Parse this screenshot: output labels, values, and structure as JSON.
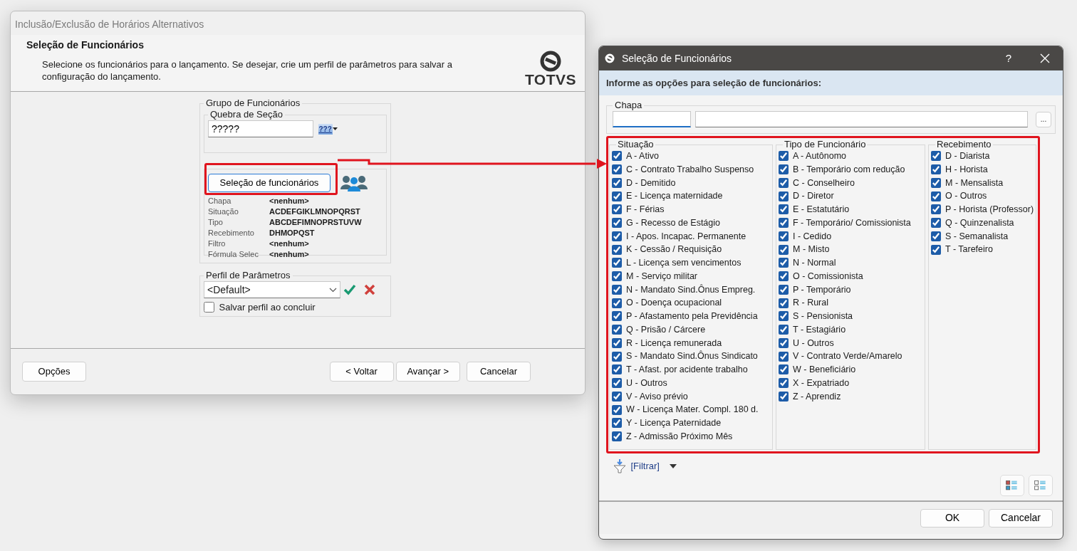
{
  "main_window": {
    "title": "Inclusão/Exclusão de Horários Alternativos",
    "heading": "Seleção de Funcionários",
    "description": "Selecione os funcionários para o lançamento. Se desejar, crie um perfil de parâmetros para salvar a configuração do lançamento.",
    "logo_text": "TOTVS",
    "group": {
      "legend": "Grupo de Funcionários",
      "section_break": {
        "legend": "Quebra de Seção",
        "value": "?????",
        "button_text": "???"
      },
      "select_button": "Seleção de funcionários",
      "summary": [
        {
          "label": "Chapa",
          "value": "<nenhum>"
        },
        {
          "label": "Situação",
          "value": "ACDEFGIKLMNOPQRST"
        },
        {
          "label": "Tipo",
          "value": "ABCDEFIMNOPRSTUVW"
        },
        {
          "label": "Recebimento",
          "value": "DHMOPQST"
        },
        {
          "label": "Filtro",
          "value": "<nenhum>"
        },
        {
          "label": "Fórmula Selec",
          "value": "<nenhum>"
        }
      ]
    },
    "profile": {
      "legend": "Perfil de Parâmetros",
      "value": "<Default>",
      "save_checkbox": {
        "label": "Salvar perfil ao concluir",
        "checked": false
      }
    },
    "buttons": {
      "options": "Opções",
      "back": "< Voltar",
      "next": "Avançar >",
      "cancel": "Cancelar"
    }
  },
  "dialog": {
    "title": "Seleção de Funcionários",
    "help": "?",
    "instruction": "Informe as opções para seleção de funcionários:",
    "chapa_legend": "Chapa",
    "more_button": "...",
    "groups": [
      {
        "legend": "Situação",
        "items": [
          {
            "label": "A - Ativo",
            "checked": true
          },
          {
            "label": "C - Contrato Trabalho Suspenso",
            "checked": true
          },
          {
            "label": "D - Demitido",
            "checked": true
          },
          {
            "label": "E - Licença maternidade",
            "checked": true
          },
          {
            "label": "F - Férias",
            "checked": true
          },
          {
            "label": "G - Recesso de Estágio",
            "checked": true
          },
          {
            "label": "I - Apos. Incapac. Permanente",
            "checked": true
          },
          {
            "label": "K - Cessão / Requisição",
            "checked": true
          },
          {
            "label": "L - Licença sem vencimentos",
            "checked": true
          },
          {
            "label": "M - Serviço militar",
            "checked": true
          },
          {
            "label": "N - Mandato Sind.Ônus Empreg.",
            "checked": true
          },
          {
            "label": "O - Doença ocupacional",
            "checked": true
          },
          {
            "label": "P - Afastamento pela Previdência",
            "checked": true
          },
          {
            "label": "Q - Prisão / Cárcere",
            "checked": true
          },
          {
            "label": "R - Licença remunerada",
            "checked": true
          },
          {
            "label": "S - Mandato Sind.Ônus Sindicato",
            "checked": true
          },
          {
            "label": "T - Afast. por acidente trabalho",
            "checked": true
          },
          {
            "label": "U - Outros",
            "checked": true
          },
          {
            "label": "V - Aviso prévio",
            "checked": true
          },
          {
            "label": "W - Licença Mater. Compl. 180 d.",
            "checked": true
          },
          {
            "label": "Y - Licença Paternidade",
            "checked": true
          },
          {
            "label": "Z - Admissão Próximo Mês",
            "checked": true
          }
        ]
      },
      {
        "legend": "Tipo de Funcionário",
        "items": [
          {
            "label": "A - Autônomo",
            "checked": true
          },
          {
            "label": "B - Temporário com redução",
            "checked": true
          },
          {
            "label": "C - Conselheiro",
            "checked": true
          },
          {
            "label": "D - Diretor",
            "checked": true
          },
          {
            "label": "E - Estatutário",
            "checked": true
          },
          {
            "label": "F - Temporário/ Comissionista",
            "checked": true
          },
          {
            "label": "I - Cedido",
            "checked": true
          },
          {
            "label": "M - Misto",
            "checked": true
          },
          {
            "label": "N - Normal",
            "checked": true
          },
          {
            "label": "O - Comissionista",
            "checked": true
          },
          {
            "label": "P - Temporário",
            "checked": true
          },
          {
            "label": "R - Rural",
            "checked": true
          },
          {
            "label": "S - Pensionista",
            "checked": true
          },
          {
            "label": "T - Estagiário",
            "checked": true
          },
          {
            "label": "U - Outros",
            "checked": true
          },
          {
            "label": "V - Contrato Verde/Amarelo",
            "checked": true
          },
          {
            "label": "W - Beneficiário",
            "checked": true
          },
          {
            "label": "X - Expatriado",
            "checked": true
          },
          {
            "label": "Z - Aprendiz",
            "checked": true
          }
        ]
      },
      {
        "legend": "Recebimento",
        "items": [
          {
            "label": "D - Diarista",
            "checked": true
          },
          {
            "label": "H - Horista",
            "checked": true
          },
          {
            "label": "M - Mensalista",
            "checked": true
          },
          {
            "label": "O - Outros",
            "checked": true
          },
          {
            "label": "P - Horista (Professor)",
            "checked": true
          },
          {
            "label": "Q - Quinzenalista",
            "checked": true
          },
          {
            "label": "S - Semanalista",
            "checked": true
          },
          {
            "label": "T - Tarefeiro",
            "checked": true
          }
        ]
      }
    ],
    "filter": "[Filtrar]",
    "buttons": [
      "OK",
      "Cancelar"
    ]
  }
}
